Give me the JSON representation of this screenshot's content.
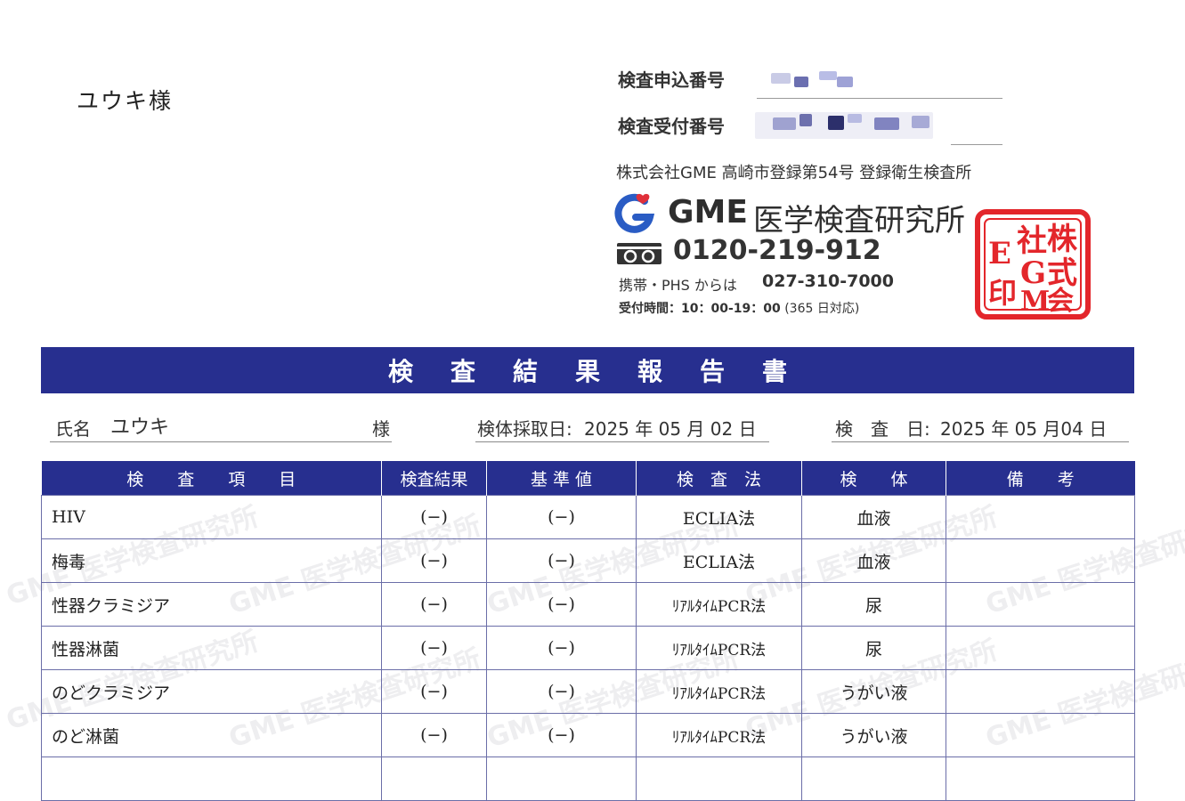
{
  "addressee": "ユウキ様",
  "numbers": {
    "application_label": "検査申込番号",
    "reception_label": "検査受付番号"
  },
  "company_line": "株式会社GME 高崎市登録第54号 登録衛生検査所",
  "lab": {
    "name_en": "GME",
    "name_ja": "医学検査研究所",
    "freedial_number": "0120-219-912",
    "mobile_label": "携帯・PHS からは",
    "mobile_number": "027-310-7000",
    "hours_label": "受付時間：",
    "hours_time": "10：00-19：00",
    "hours_note": "(365 日対応)"
  },
  "seal_text": "株式会社GME",
  "report_title": "検査結果報告書",
  "patient": {
    "name_label": "氏名",
    "name": "ユウキ",
    "honorific": "様"
  },
  "sample_date": {
    "label": "検体採取日:",
    "value": "2025 年 05 月 02 日"
  },
  "test_date": {
    "label": "検　査　日:",
    "value": "2025 年 05 月04 日"
  },
  "table": {
    "headers": [
      "検　　査　　項　　目",
      "検査結果",
      "基 準 値",
      "検　査　法",
      "検　　体",
      "備　　考"
    ],
    "rows": [
      {
        "item": "HIV",
        "result": "(−)",
        "reference": "(−)",
        "method": "ECLIA法",
        "specimen": "血液",
        "note": ""
      },
      {
        "item": "梅毒",
        "result": "(−)",
        "reference": "(−)",
        "method": "ECLIA法",
        "specimen": "血液",
        "note": ""
      },
      {
        "item": "性器クラミジア",
        "result": "(−)",
        "reference": "(−)",
        "method": "ﾘｱﾙﾀｲﾑPCR法",
        "specimen": "尿",
        "note": ""
      },
      {
        "item": "性器淋菌",
        "result": "(−)",
        "reference": "(−)",
        "method": "ﾘｱﾙﾀｲﾑPCR法",
        "specimen": "尿",
        "note": ""
      },
      {
        "item": "のどクラミジア",
        "result": "(−)",
        "reference": "(−)",
        "method": "ﾘｱﾙﾀｲﾑPCR法",
        "specimen": "うがい液",
        "note": ""
      },
      {
        "item": "のど淋菌",
        "result": "(−)",
        "reference": "(−)",
        "method": "ﾘｱﾙﾀｲﾑPCR法",
        "specimen": "うがい液",
        "note": ""
      },
      {
        "item": "",
        "result": "",
        "reference": "",
        "method": "",
        "specimen": "",
        "note": ""
      }
    ]
  },
  "watermark": "GME 医学検査研究所",
  "colors": {
    "header_navy": "#272f8f",
    "logo_blue": "#2a5cc4",
    "logo_red": "#e0303a",
    "seal_red": "#e3262b"
  },
  "icons": {
    "logo": "gme-logo-icon",
    "freedial": "freedial-icon",
    "seal": "company-seal-icon"
  }
}
